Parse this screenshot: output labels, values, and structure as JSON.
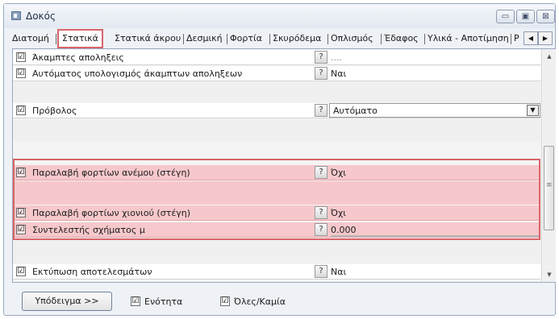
{
  "window": {
    "title": "Δοκός",
    "minimize_glyph": "▭",
    "maximize_glyph": "▣",
    "close_glyph": "⊠"
  },
  "tabs": [
    {
      "label": "Διατομή"
    },
    {
      "label": "Στατικά"
    },
    {
      "label": "Στατικά άκρου"
    },
    {
      "label": "Δεσμική"
    },
    {
      "label": "Φορτία"
    },
    {
      "label": "Σκυρόδεμα"
    },
    {
      "label": "Οπλισμός"
    },
    {
      "label": "Έδαφος"
    },
    {
      "label": "Υλικά - Αποτίμηση"
    },
    {
      "label": "Ρ"
    }
  ],
  "tab_scroll": {
    "left": "◀",
    "right": "▶"
  },
  "rows": [
    {
      "checked": "☑",
      "label": "Άκαμπτες αποληξεις",
      "help": "?",
      "value": "...."
    },
    {
      "checked": "☑",
      "label": "Αυτόματος υπολογισμός άκαμπτων αποληξεων",
      "help": "?",
      "value": "Ναι"
    },
    {
      "checked": "☑",
      "label": "Πρόβολος",
      "help": "?",
      "value": "Αυτόματο",
      "drop": "▼"
    },
    {
      "checked": "☑",
      "label": "Παραλαβή φορτίων ανέμου (στέγη)",
      "help": "?",
      "value": "Όχι"
    },
    {
      "checked": "☑",
      "label": "Παραλαβή φορτίων χιονιού (στέγη)",
      "help": "?",
      "value": "Όχι"
    },
    {
      "checked": "☑",
      "label": "Συντελεστής σχήματος μ",
      "help": "?",
      "value": "0.000"
    },
    {
      "checked": "☑",
      "label": "Εκτύπωση αποτελεσμάτων",
      "help": "?",
      "value": "Ναι"
    }
  ],
  "scrollbar": {
    "up": "▲",
    "down": "▼"
  },
  "footer": {
    "example_button": "Υπόδειγμα >>",
    "unit_check": "☑",
    "unit_label": "Ενότητα",
    "all_check": "☑",
    "all_label": "Όλες/Καμία"
  },
  "colors": {
    "highlight": "#f6c8cb",
    "highlight_border": "#d9646a"
  }
}
